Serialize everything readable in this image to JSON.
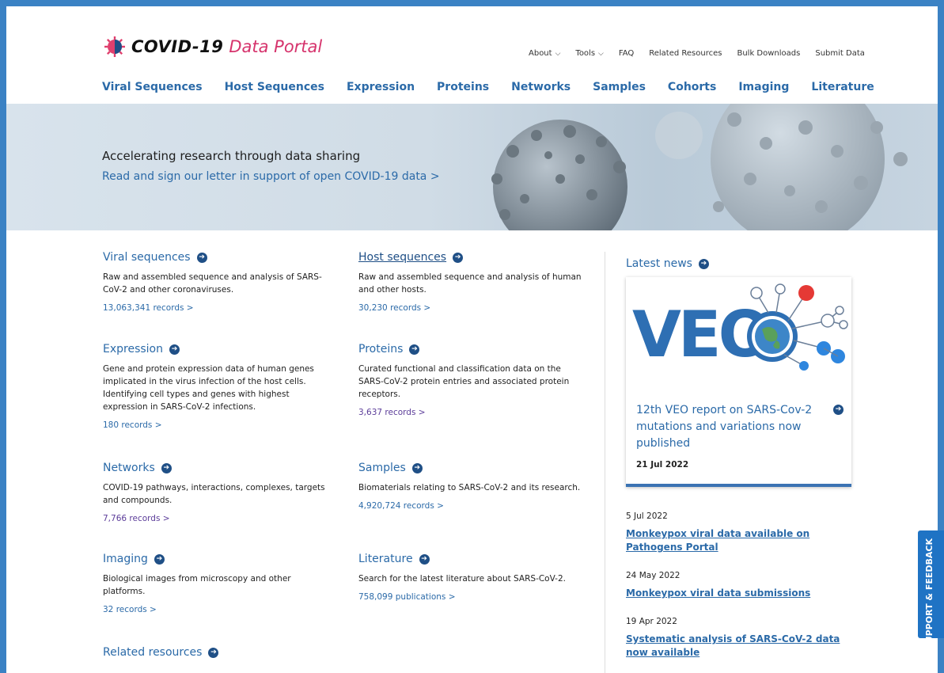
{
  "logo": {
    "covid": "COVID-19",
    "portal": "Data Portal"
  },
  "top_nav": [
    {
      "label": "About",
      "has_caret": true
    },
    {
      "label": "Tools",
      "has_caret": true
    },
    {
      "label": "FAQ",
      "has_caret": false
    },
    {
      "label": "Related Resources",
      "has_caret": false
    },
    {
      "label": "Bulk Downloads",
      "has_caret": false
    },
    {
      "label": "Submit Data",
      "has_caret": false
    }
  ],
  "main_nav": [
    "Viral Sequences",
    "Host Sequences",
    "Expression",
    "Proteins",
    "Networks",
    "Samples",
    "Cohorts",
    "Imaging",
    "Literature"
  ],
  "hero": {
    "title": "Accelerating research through data sharing",
    "link": "Read and sign our letter in support of open COVID-19 data >"
  },
  "sections": {
    "viral": {
      "title": "Viral sequences",
      "desc": "Raw and assembled sequence and analysis of SARS-CoV-2 and other coronaviruses.",
      "records": "13,063,341 records >"
    },
    "host": {
      "title": "Host sequences",
      "desc": "Raw and assembled sequence and analysis of human and other hosts.",
      "records": "30,230 records >"
    },
    "expression": {
      "title": "Expression",
      "desc": "Gene and protein expression data of human genes implicated in the virus infection of the host cells. Identifying cell types and genes with highest expression in SARS-CoV-2 infections.",
      "records": "180 records >"
    },
    "proteins": {
      "title": "Proteins",
      "desc": "Curated functional and classification data on the SARS-CoV-2 protein entries and associated protein receptors.",
      "records": "3,637 records >"
    },
    "networks": {
      "title": "Networks",
      "desc": "COVID-19 pathways, interactions, complexes, targets and compounds.",
      "records": "7,766 records >"
    },
    "samples": {
      "title": "Samples",
      "desc": "Biomaterials relating to SARS-CoV-2 and its research.",
      "records": "4,920,724 records >"
    },
    "imaging": {
      "title": "Imaging",
      "desc": "Biological images from microscopy and other platforms.",
      "records": "32 records >"
    },
    "literature": {
      "title": "Literature",
      "desc": "Search for the latest literature about SARS-CoV-2.",
      "records": "758,099 publications >"
    },
    "related": {
      "title": "Related resources"
    }
  },
  "news": {
    "heading": "Latest news",
    "featured": {
      "logo_text": "VEO",
      "title": "12th VEO report on SARS-Cov-2 mutations and variations now published",
      "date": "21 Jul 2022"
    },
    "items": [
      {
        "date": "5 Jul 2022",
        "title": "Monkeypox viral data available on Pathogens Portal"
      },
      {
        "date": "24 May 2022",
        "title": "Monkeypox viral data submissions"
      },
      {
        "date": "19 Apr 2022",
        "title": "Systematic analysis of SARS-CoV-2 data now available"
      }
    ]
  },
  "support_tab": {
    "label": "SUPPORT & FEEDBACK"
  },
  "colors": {
    "accent_blue": "#2b6aa8",
    "dark_blue": "#1f4f86",
    "brand_pink": "#d6336c",
    "frame_blue": "#3b82c4"
  }
}
